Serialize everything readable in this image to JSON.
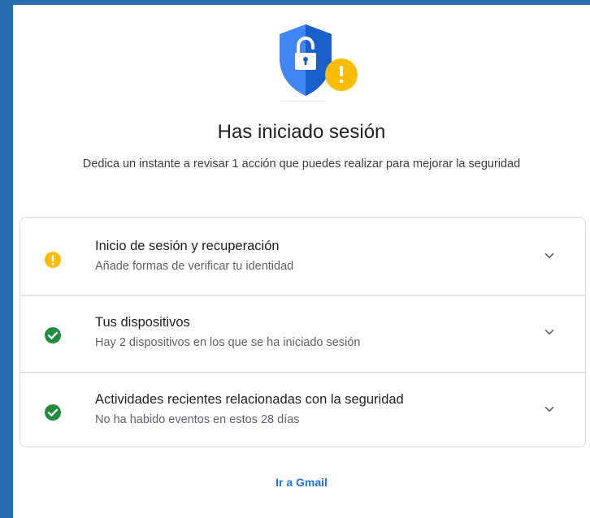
{
  "header": {
    "title": "Has iniciado sesión",
    "subtitle": "Dedica un instante a revisar 1 acción que puedes realizar para mejorar la seguridad"
  },
  "checklist": {
    "items": [
      {
        "status": "warning",
        "icon": "warning-circle-icon",
        "color": "#fbbc04",
        "title": "Inicio de sesión y recuperación",
        "description": "Añade formas de verificar tu identidad"
      },
      {
        "status": "ok",
        "icon": "check-circle-icon",
        "color": "#1e8e3e",
        "title": "Tus dispositivos",
        "description": "Hay 2 dispositivos en los que se ha iniciado sesión"
      },
      {
        "status": "ok",
        "icon": "check-circle-icon",
        "color": "#1e8e3e",
        "title": "Actividades recientes relacionadas con la seguridad",
        "description": "No ha habido eventos en estos 28 días"
      }
    ]
  },
  "footer": {
    "link_label": "Ir a Gmail"
  },
  "colors": {
    "page_background": "#2a6db3",
    "shield_blue": "#4285f4",
    "shield_dark": "#1a5fc9",
    "warning": "#fbbc04",
    "ok": "#1e8e3e",
    "link": "#1a73e8"
  }
}
